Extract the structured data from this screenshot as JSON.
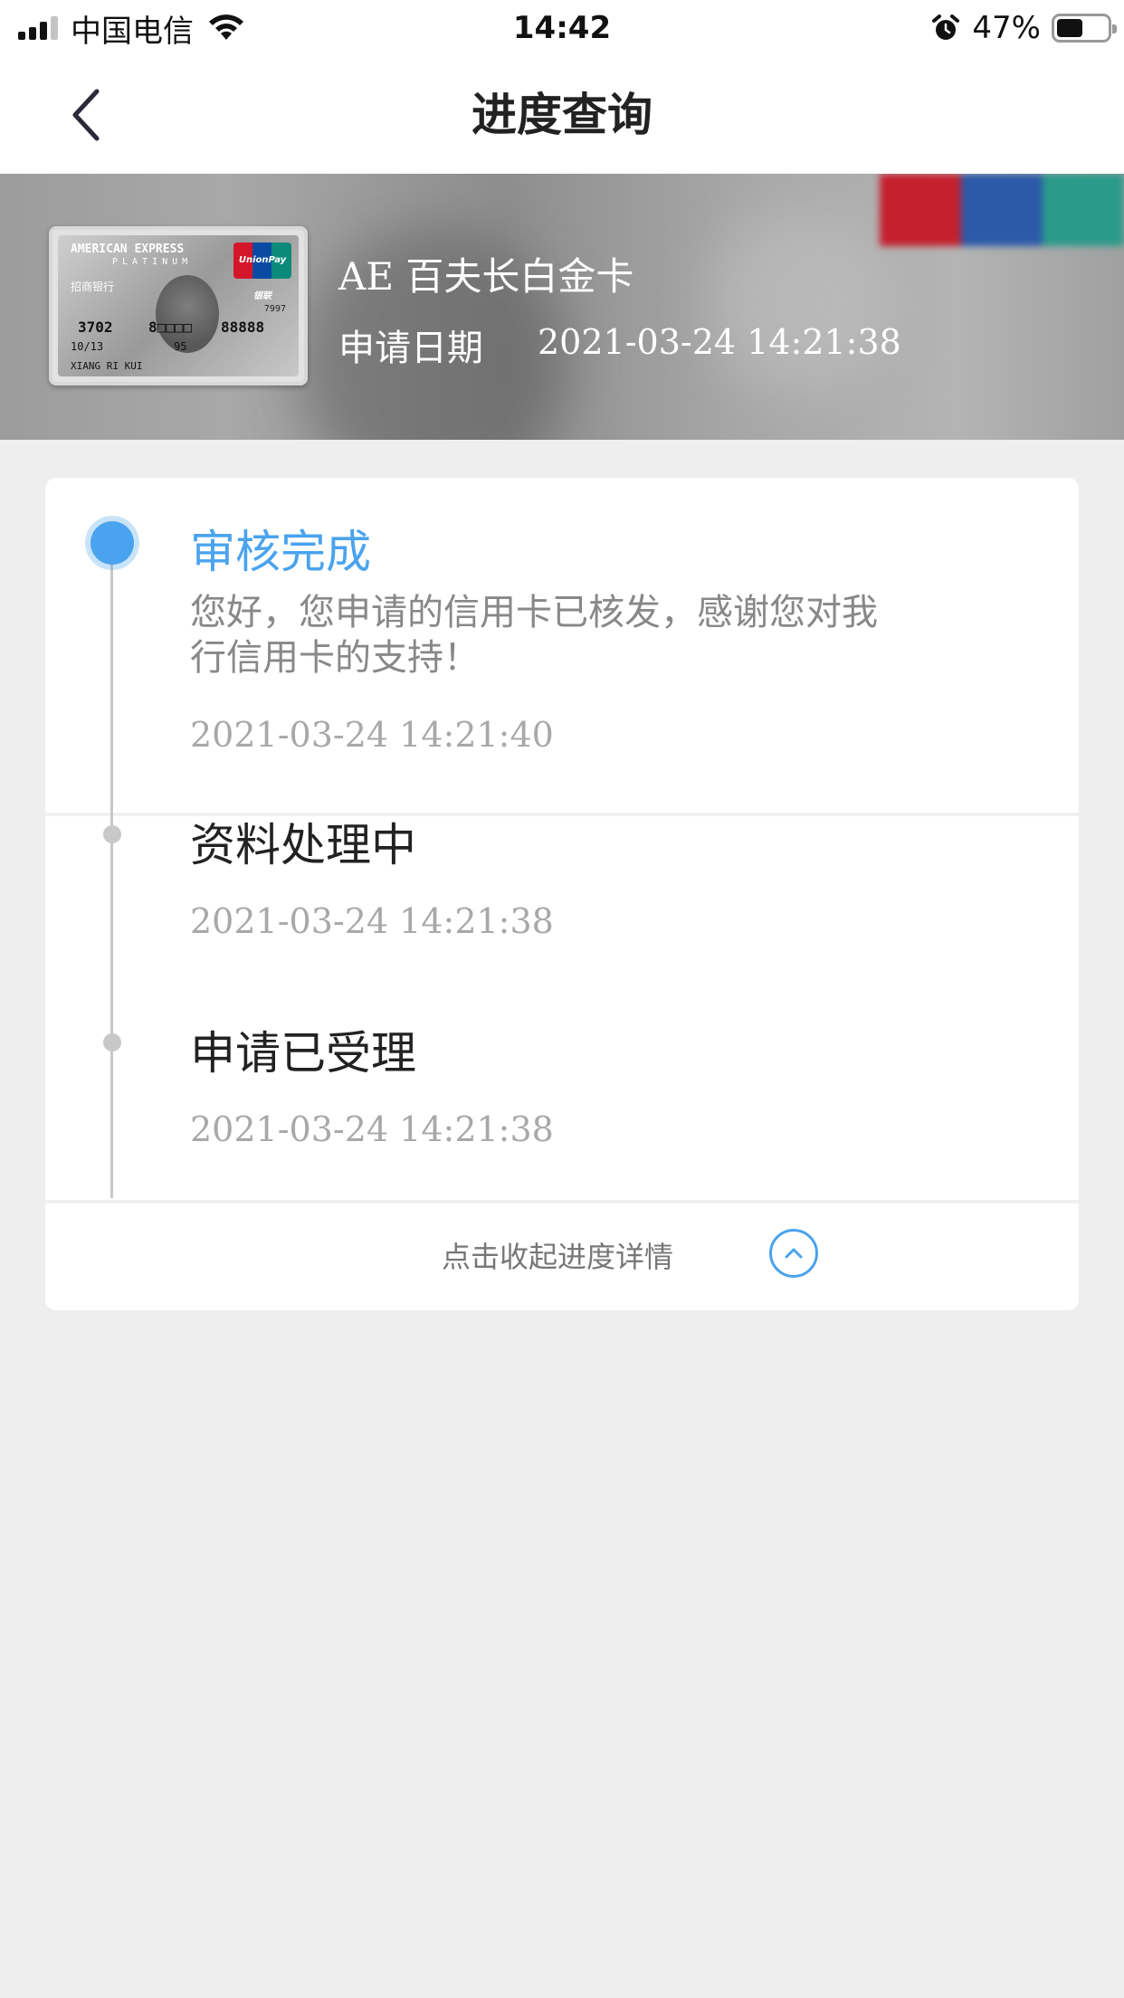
{
  "status_bar": {
    "carrier": "中国电信",
    "time": "14:42",
    "battery_percent": "47%",
    "battery_level": 0.47
  },
  "nav": {
    "title": "进度查询",
    "back_icon": "chevron-left-icon"
  },
  "card": {
    "name": "AE 百夫长白金卡",
    "apply_label": "申请日期",
    "apply_date": "2021-03-24 14:21:38",
    "thumb": {
      "brand": "AMERICAN EXPRESS",
      "tier": "PLATINUM",
      "bank": "招商银行",
      "number_left": "3702",
      "number_mid": "8□□□□",
      "number_right": "88888",
      "small_num": "7997",
      "valid": "10/13",
      "code": "95",
      "holder": "XIANG RI KUI",
      "network": "UnionPay 银联"
    }
  },
  "timeline": {
    "steps": [
      {
        "title": "审核完成",
        "desc": "您好，您申请的信用卡已核发，感谢您对我行信用卡的支持！",
        "time": "2021-03-24 14:21:40",
        "active": true
      },
      {
        "title": "资料处理中",
        "time": "2021-03-24 14:21:38",
        "active": false
      },
      {
        "title": "申请已受理",
        "time": "2021-03-24 14:21:38",
        "active": false
      }
    ],
    "collapse_label": "点击收起进度详情",
    "collapse_icon": "chevron-up-circle-icon"
  },
  "colors": {
    "accent": "#4aa3ee",
    "background": "#eeeeee",
    "timeline_gray": "#c8c8c8"
  }
}
